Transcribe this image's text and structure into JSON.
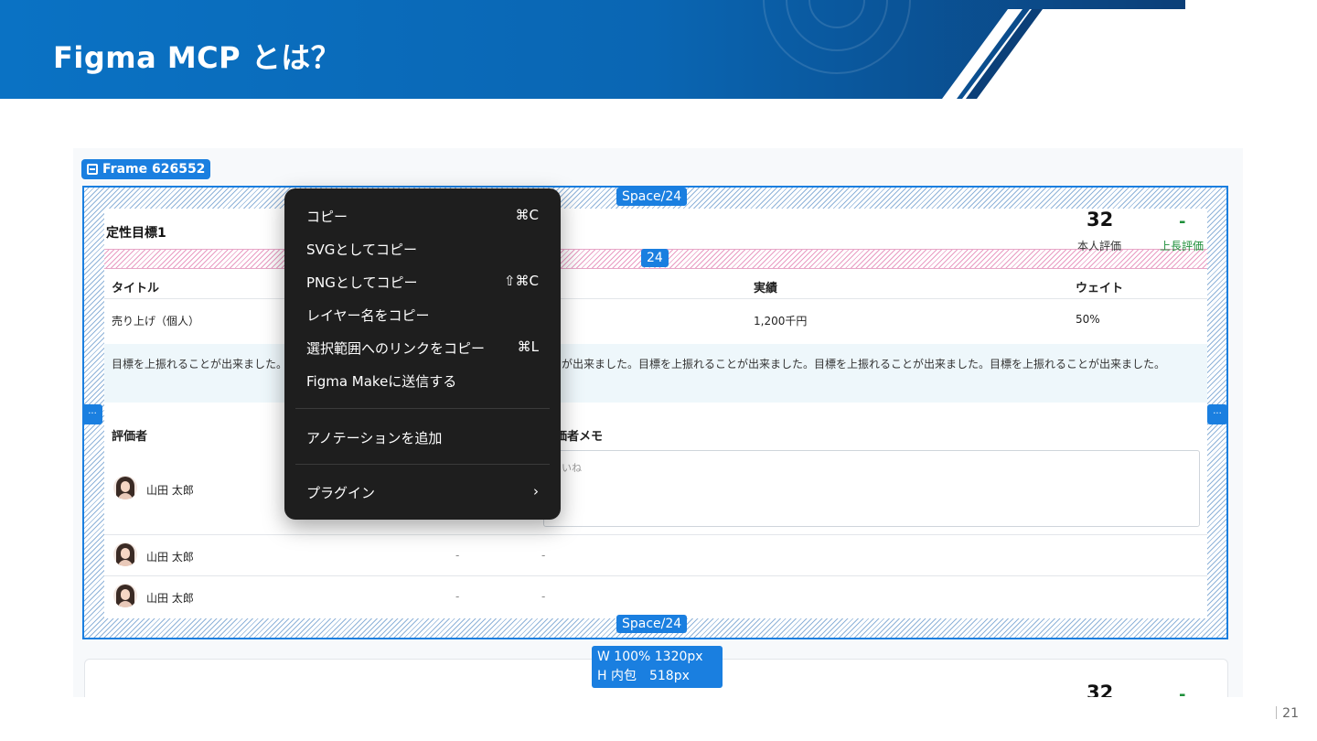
{
  "slide": {
    "title": "Figma MCP とは？",
    "page_number": "21"
  },
  "colors": {
    "banner_blue": "#0a6fbf",
    "selection_blue": "#1a7fe0",
    "menu_bg": "#1e1e1e",
    "green": "#1e8f3a"
  },
  "figma": {
    "frame_name": "Frame 626552",
    "frame_icon": "frame-icon",
    "spacing_top": "Space/24",
    "spacing_bottom": "Space/24",
    "gap_value": "24",
    "side_handle": "...",
    "dimensions": {
      "width_line": "W 100% 1320px",
      "height_line": "H 内包　518px"
    }
  },
  "card": {
    "section_title": "定性目標1",
    "score": "32",
    "score_dash": "-",
    "self_eval_label": "本人評価",
    "boss_eval_label": "上長評価",
    "table_headers": [
      "タイトル",
      "実績",
      "ウェイト"
    ],
    "table_row": [
      "売り上げ（個人）",
      "1,200千円",
      "50%"
    ],
    "comment": "目標を上振れることが出来ました。目標を上振れることが出来ました。目標を上振れることが出来ました。目標を上振れることが出来ました。目標を上振れることが出来ました。目標を上振れることが出来ました。",
    "evaluator_header": "評価者",
    "memo_header": "評価者メモ",
    "memo_text": "いいね",
    "evaluators": [
      {
        "name": "山田 太郎",
        "score": "",
        "memo": ""
      },
      {
        "name": "山田 太郎",
        "score": "-",
        "memo": "-"
      },
      {
        "name": "山田 太郎",
        "score": "-",
        "memo": "-"
      }
    ]
  },
  "card2": {
    "score": "32",
    "score_dash": "-"
  },
  "context_menu": {
    "items": [
      {
        "label": "コピー",
        "shortcut": "⌘C"
      },
      {
        "label": "SVGとしてコピー",
        "shortcut": ""
      },
      {
        "label": "PNGとしてコピー",
        "shortcut": "⇧⌘C"
      },
      {
        "label": "レイヤー名をコピー",
        "shortcut": ""
      },
      {
        "label": "選択範囲へのリンクをコピー",
        "shortcut": "⌘L"
      },
      {
        "label": "Figma Makeに送信する",
        "shortcut": ""
      },
      {
        "label": "アノテーションを追加",
        "shortcut": ""
      },
      {
        "label": "プラグイン",
        "shortcut": "›"
      }
    ]
  }
}
